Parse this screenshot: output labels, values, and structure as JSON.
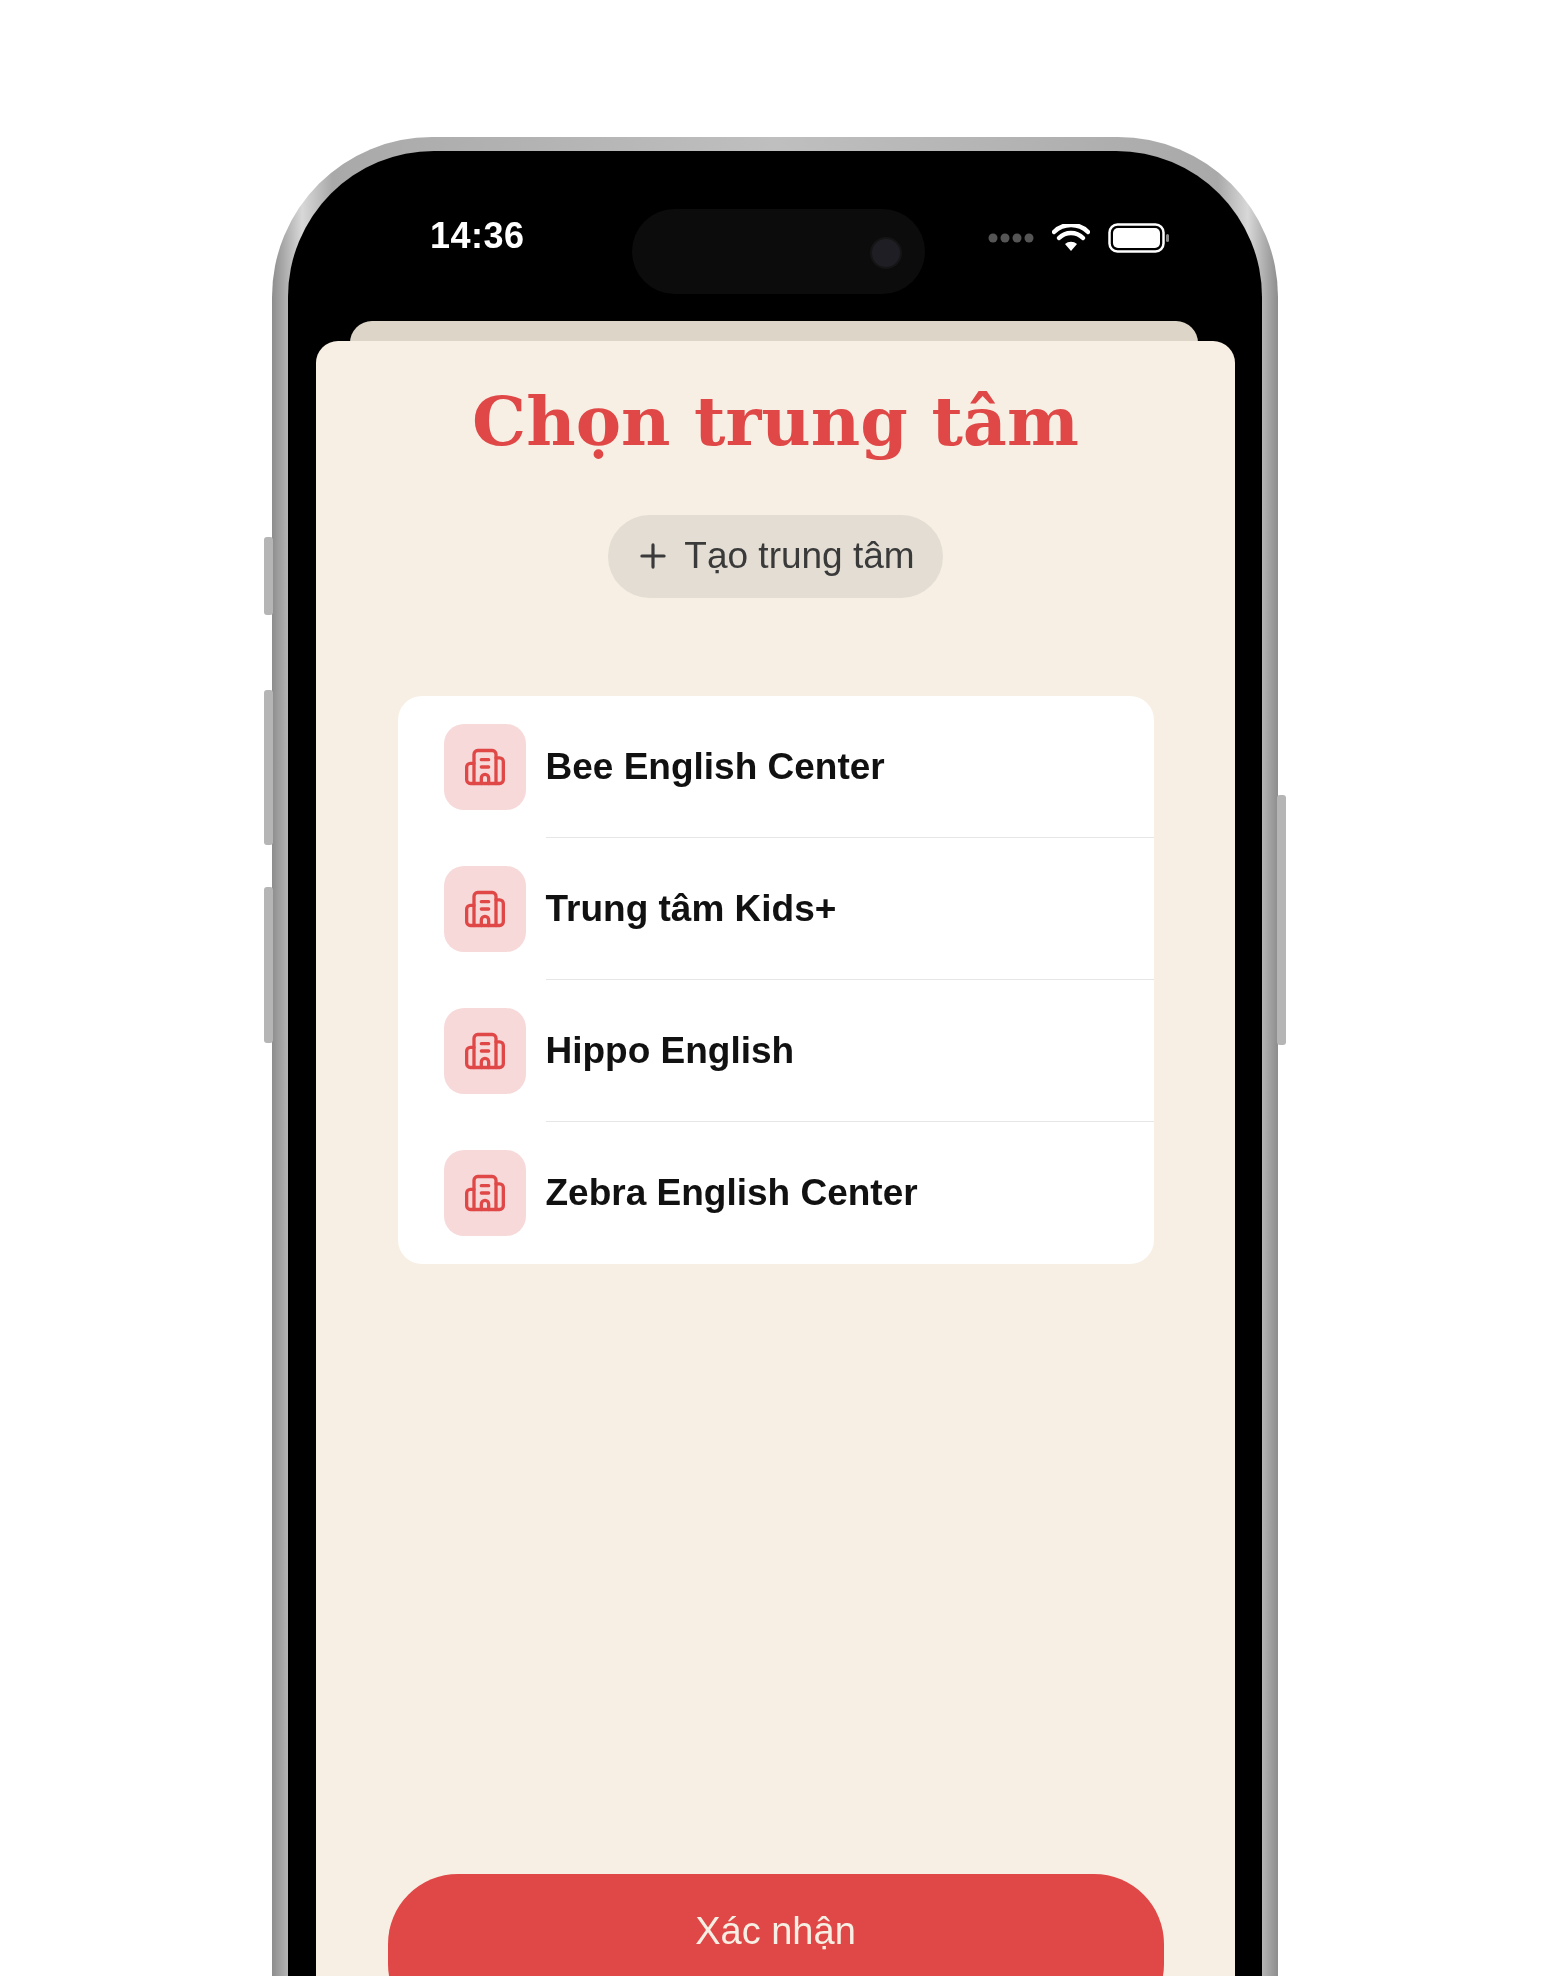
{
  "status_bar": {
    "time": "14:36"
  },
  "title": "Chọn trung tâm",
  "create_button": {
    "label": "Tạo trung tâm"
  },
  "centers": [
    {
      "name": "Bee English Center"
    },
    {
      "name": "Trung tâm Kids+"
    },
    {
      "name": "Hippo English"
    },
    {
      "name": "Zebra English Center"
    }
  ],
  "confirm_button": {
    "label": "Xác nhận"
  }
}
